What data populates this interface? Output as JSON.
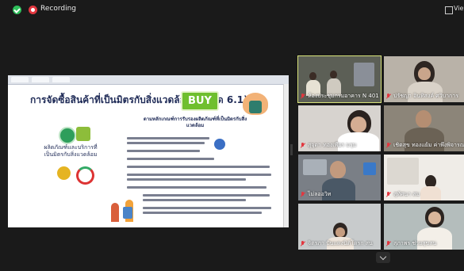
{
  "recording": {
    "label": "Recording"
  },
  "view": {
    "label": "View"
  },
  "slide": {
    "title": "การจัดซื้อสินค้าที่เป็นมิตรกับสิ่งแวดล้อม (หมวด 6.1)",
    "buy_label": "BUY",
    "left_label": "ผลิตภัณฑ์และบริการที่เป็นมิตรกับสิ่งแวดล้อม",
    "criteria_title": "ตามหลักเกณฑ์การรับรองผลิตภัณฑ์ที่เป็นมิตรกับสิ่งแวดล้อม"
  },
  "participants": [
    {
      "name": "ห้องประชุมกรมอาคาร N 401"
    },
    {
      "name": "ปรัชญา อินทิสงค์ ศวิบาการ"
    },
    {
      "name": "สุจุดา ทองเพียร มรุม"
    },
    {
      "name": "เชิดสุข ทองแย้ม ค่าพึงพิจารณา"
    },
    {
      "name": "ไม่ลออวิท"
    },
    {
      "name": "สุทัศนา สม"
    },
    {
      "name": "จิตรภา ปันแดงนิติโดรก สน"
    },
    {
      "name": "สุภาพร ช่วยสุขสน"
    }
  ]
}
